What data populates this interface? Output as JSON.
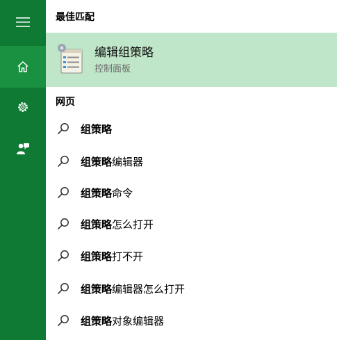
{
  "sidebar": {
    "items": [
      {
        "name": "menu",
        "icon": "hamburger-icon"
      },
      {
        "name": "home",
        "icon": "home-icon",
        "selected": true
      },
      {
        "name": "settings",
        "icon": "gear-icon"
      },
      {
        "name": "feedback",
        "icon": "feedback-icon"
      }
    ],
    "accent": "#0f7a33",
    "selected_bg": "#1a9141"
  },
  "best_match": {
    "header": "最佳匹配",
    "title": "编辑组策略",
    "subtitle": "控制面板",
    "icon": "group-policy-icon",
    "highlight": "#bfe6c8"
  },
  "web": {
    "header": "网页",
    "suggestions": [
      {
        "bold": "组策略",
        "rest": ""
      },
      {
        "bold": "组策略",
        "rest": "编辑器"
      },
      {
        "bold": "组策略",
        "rest": "命令"
      },
      {
        "bold": "组策略",
        "rest": "怎么打开"
      },
      {
        "bold": "组策略",
        "rest": "打不开"
      },
      {
        "bold": "组策略",
        "rest": "编辑器怎么打开"
      },
      {
        "bold": "组策略",
        "rest": "对象编辑器"
      }
    ]
  }
}
